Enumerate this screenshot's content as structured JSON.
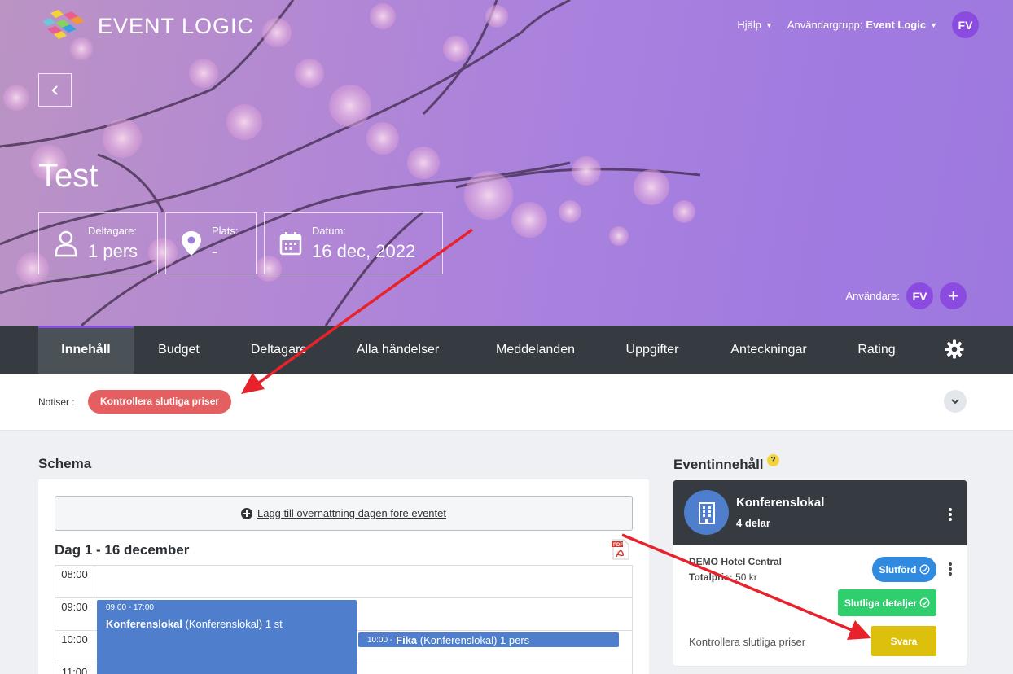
{
  "header": {
    "logo_text": "EVENT LOGIC",
    "help_label": "Hjälp",
    "user_group_label": "Användargrupp:",
    "user_group_value": "Event Logic",
    "avatar_initials": "FV"
  },
  "event": {
    "title": "Test",
    "participants_label": "Deltagare:",
    "participants_value": "1 pers",
    "place_label": "Plats:",
    "place_value": "-",
    "date_label": "Datum:",
    "date_value": "16 dec, 2022",
    "users_label": "Användare:",
    "users_avatar": "FV",
    "add_user_symbol": "+"
  },
  "nav": {
    "tabs": [
      {
        "label": "Innehåll",
        "active": true
      },
      {
        "label": "Budget"
      },
      {
        "label": "Deltagare"
      },
      {
        "label": "Alla händelser"
      },
      {
        "label": "Meddelanden"
      },
      {
        "label": "Uppgifter"
      },
      {
        "label": "Anteckningar"
      },
      {
        "label": "Rating"
      }
    ]
  },
  "notices": {
    "label": "Notiser :",
    "items": [
      "Kontrollera slutliga priser"
    ]
  },
  "schedule": {
    "title": "Schema",
    "add_overnight": "Lägg till övernattning dagen före eventet",
    "day_title": "Dag 1 - 16 december",
    "times": [
      "08:00",
      "09:00",
      "10:00",
      "11:00"
    ],
    "blocks": [
      {
        "time": "09:00 - 17:00",
        "name": "Konferenslokal",
        "detail": "(Konferenslokal) 1 st"
      },
      {
        "time": "10:00 -",
        "name": "Fika",
        "detail": "(Konferenslokal) 1 pers"
      }
    ]
  },
  "event_content": {
    "title": "Eventinnehåll",
    "help": "?",
    "card": {
      "name": "Konferenslokal",
      "parts": "4 delar",
      "hotel": "DEMO Hotel Central",
      "price_label": "Totalpris:",
      "price_value": "50 kr",
      "status_done": "Slutförd",
      "status_final": "Slutliga detaljer",
      "message": "Kontrollera slutliga priser",
      "reply_button": "Svara"
    }
  },
  "colors": {
    "accent": "#8c4be0",
    "nav_bg": "#353b40",
    "notice_red": "#e55f61",
    "block_blue": "#4f7fcc",
    "status_blue": "#2f8ae0",
    "status_green": "#2fcf6e",
    "reply_yellow": "#dcc00c",
    "arrow_red": "#e8222a"
  }
}
